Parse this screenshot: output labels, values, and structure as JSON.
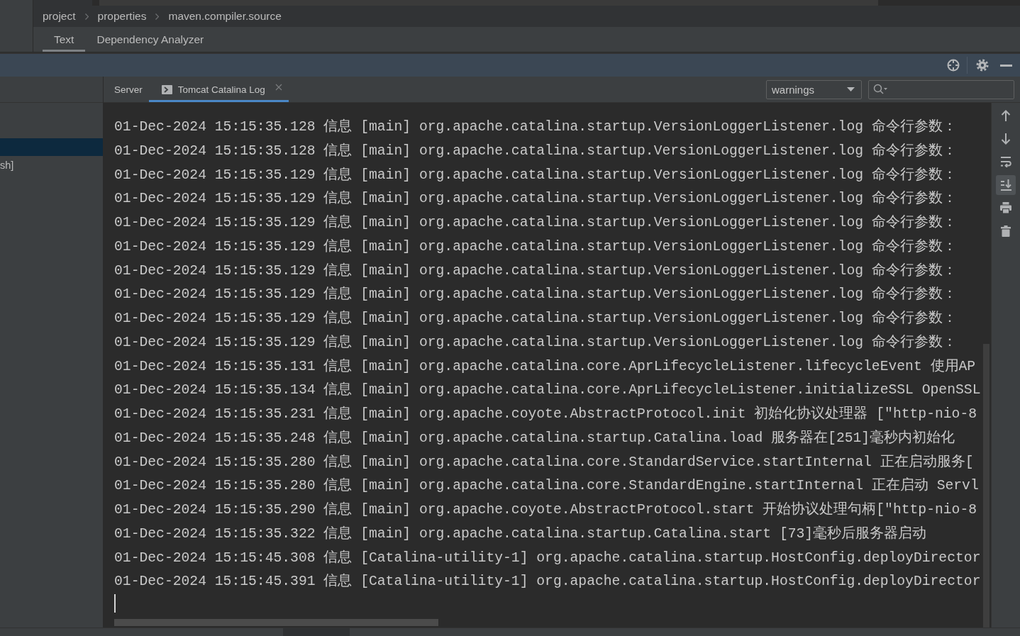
{
  "breadcrumb": [
    "project",
    "properties",
    "maven.compiler.source"
  ],
  "editor_tabs": [
    {
      "label": "Text",
      "selected": true
    },
    {
      "label": "Dependency Analyzer",
      "selected": false
    }
  ],
  "header_actions": [
    {
      "kind": "locate"
    },
    {
      "kind": "settings"
    },
    {
      "kind": "hide"
    }
  ],
  "side_list": [
    {
      "selected": true
    },
    {
      "label": "sh]",
      "selected": false
    }
  ],
  "log_tabs": [
    {
      "label": "Server",
      "selected": false,
      "closable": false,
      "kind": "plain"
    },
    {
      "label": "Tomcat Catalina Log",
      "selected": true,
      "closable": true,
      "kind": "console"
    }
  ],
  "filter": {
    "value": "warnings"
  },
  "log_lines": [
    "01-Dec-2024 15:15:35.128 信息 [main] org.apache.catalina.startup.VersionLoggerListener.log 命令行参数：",
    "01-Dec-2024 15:15:35.128 信息 [main] org.apache.catalina.startup.VersionLoggerListener.log 命令行参数：",
    "01-Dec-2024 15:15:35.129 信息 [main] org.apache.catalina.startup.VersionLoggerListener.log 命令行参数：",
    "01-Dec-2024 15:15:35.129 信息 [main] org.apache.catalina.startup.VersionLoggerListener.log 命令行参数：",
    "01-Dec-2024 15:15:35.129 信息 [main] org.apache.catalina.startup.VersionLoggerListener.log 命令行参数：",
    "01-Dec-2024 15:15:35.129 信息 [main] org.apache.catalina.startup.VersionLoggerListener.log 命令行参数：",
    "01-Dec-2024 15:15:35.129 信息 [main] org.apache.catalina.startup.VersionLoggerListener.log 命令行参数：",
    "01-Dec-2024 15:15:35.129 信息 [main] org.apache.catalina.startup.VersionLoggerListener.log 命令行参数：",
    "01-Dec-2024 15:15:35.129 信息 [main] org.apache.catalina.startup.VersionLoggerListener.log 命令行参数：",
    "01-Dec-2024 15:15:35.129 信息 [main] org.apache.catalina.startup.VersionLoggerListener.log 命令行参数：",
    "01-Dec-2024 15:15:35.131 信息 [main] org.apache.catalina.core.AprLifecycleListener.lifecycleEvent 使用AP",
    "01-Dec-2024 15:15:35.134 信息 [main] org.apache.catalina.core.AprLifecycleListener.initializeSSL OpenSSL",
    "01-Dec-2024 15:15:35.231 信息 [main] org.apache.coyote.AbstractProtocol.init 初始化协议处理器 [\"http-nio-8",
    "01-Dec-2024 15:15:35.248 信息 [main] org.apache.catalina.startup.Catalina.load 服务器在[251]毫秒内初始化",
    "01-Dec-2024 15:15:35.280 信息 [main] org.apache.catalina.core.StandardService.startInternal 正在启动服务[",
    "01-Dec-2024 15:15:35.280 信息 [main] org.apache.catalina.core.StandardEngine.startInternal 正在启动 Servl",
    "01-Dec-2024 15:15:35.290 信息 [main] org.apache.coyote.AbstractProtocol.start 开始协议处理句柄[\"http-nio-8",
    "01-Dec-2024 15:15:35.322 信息 [main] org.apache.catalina.startup.Catalina.start [73]毫秒后服务器启动",
    "01-Dec-2024 15:15:45.308 信息 [Catalina-utility-1] org.apache.catalina.startup.HostConfig.deployDirector",
    "01-Dec-2024 15:15:45.391 信息 [Catalina-utility-1] org.apache.catalina.startup.HostConfig.deployDirector"
  ],
  "log_actions": [
    {
      "kind": "up",
      "on": false
    },
    {
      "kind": "down",
      "on": false
    },
    {
      "kind": "wrap",
      "on": false
    },
    {
      "kind": "scroll-end",
      "on": true
    },
    {
      "kind": "print",
      "on": false
    },
    {
      "kind": "clear",
      "on": false
    }
  ]
}
